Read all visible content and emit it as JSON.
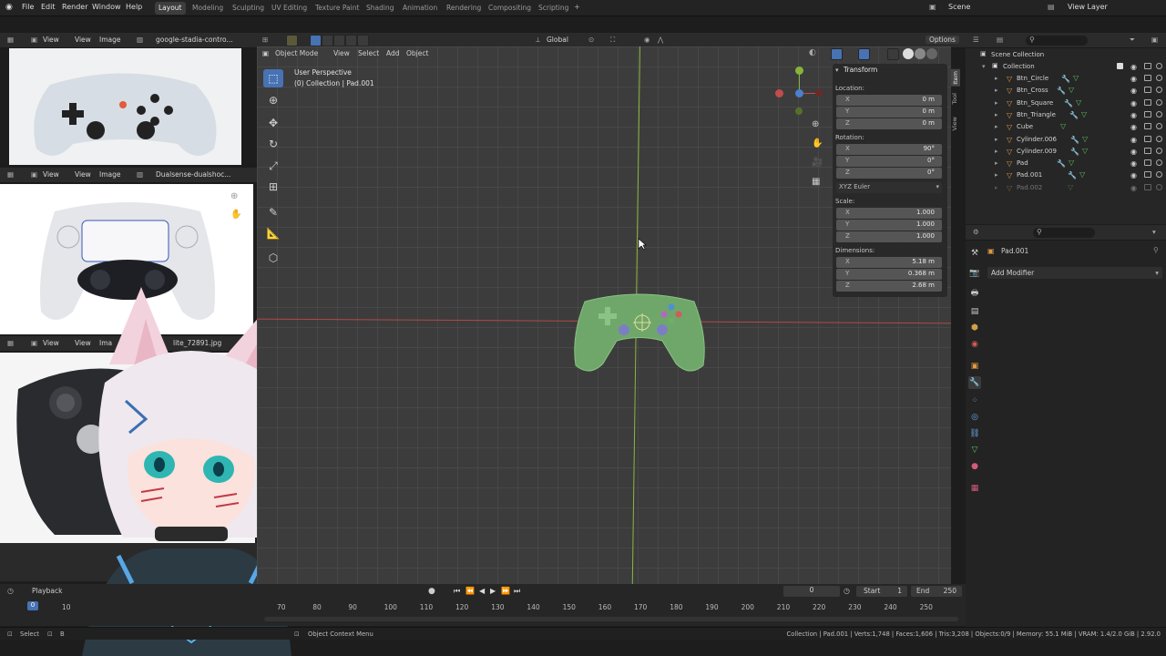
{
  "menu": {
    "file": "File",
    "edit": "Edit",
    "render": "Render",
    "window": "Window",
    "help": "Help"
  },
  "workspaces": [
    "Layout",
    "Modeling",
    "Sculpting",
    "UV Editing",
    "Texture Paint",
    "Shading",
    "Animation",
    "Rendering",
    "Compositing",
    "Scripting"
  ],
  "scene_label": "Scene",
  "view_layer_label": "View Layer",
  "image_editors": [
    {
      "view": "View",
      "view2": "View",
      "image": "Image",
      "file": "google-stadia-contro..."
    },
    {
      "view": "View",
      "view2": "View",
      "image": "Image",
      "file": "Dualsense-dualshoc..."
    },
    {
      "view": "View",
      "view2": "View",
      "image": "Ima",
      "file": "lite_72891.jpg"
    }
  ],
  "viewport": {
    "transform_orientation": "Global",
    "options": "Options",
    "mode": "Object Mode",
    "menu_view": "View",
    "menu_select": "Select",
    "menu_add": "Add",
    "menu_object": "Object",
    "perspective": "User Perspective",
    "collection_info": "(0) Collection | Pad.001"
  },
  "npanel": {
    "title": "Transform",
    "location_label": "Location:",
    "rotation_label": "Rotation:",
    "scale_label": "Scale:",
    "dimensions_label": "Dimensions:",
    "rotation_mode": "XYZ Euler",
    "location": [
      {
        "axis": "X",
        "value": "0 m"
      },
      {
        "axis": "Y",
        "value": "0 m"
      },
      {
        "axis": "Z",
        "value": "0 m"
      }
    ],
    "rotation": [
      {
        "axis": "X",
        "value": "90°"
      },
      {
        "axis": "Y",
        "value": "0°"
      },
      {
        "axis": "Z",
        "value": "0°"
      }
    ],
    "scale": [
      {
        "axis": "X",
        "value": "1.000"
      },
      {
        "axis": "Y",
        "value": "1.000"
      },
      {
        "axis": "Z",
        "value": "1.000"
      }
    ],
    "dimensions": [
      {
        "axis": "X",
        "value": "5.18 m"
      },
      {
        "axis": "Y",
        "value": "0.368 m"
      },
      {
        "axis": "Z",
        "value": "2.68 m"
      }
    ],
    "side_tabs": [
      "Item",
      "Tool",
      "View"
    ]
  },
  "outliner": {
    "scene_collection": "Scene Collection",
    "collection": "Collection",
    "items": [
      "Btn_Circle",
      "Btn_Cross",
      "Btn_Square",
      "Btn_Triangle",
      "Cube",
      "Cylinder.006",
      "Cylinder.009",
      "Pad",
      "Pad.001",
      "Pad.002"
    ]
  },
  "properties": {
    "object_name": "Pad.001",
    "add_modifier": "Add Modifier"
  },
  "timeline": {
    "playback": "Playback",
    "current_frame": "0",
    "start_label": "Start",
    "start": "1",
    "end_label": "End",
    "end": "250",
    "ruler": [
      "70",
      "80",
      "90",
      "100",
      "110",
      "120",
      "130",
      "140",
      "150",
      "160",
      "170",
      "180",
      "190",
      "200",
      "210",
      "220",
      "230",
      "240",
      "250"
    ],
    "left_ruler": [
      "0",
      "10"
    ]
  },
  "status": {
    "select": "Select",
    "select2": "B",
    "context_menu": "Object Context Menu",
    "stats": "Collection | Pad.001 | Verts:1,748 | Faces:1,606 | Tris:3,208 | Objects:0/9 | Memory: 55.1 MiB | VRAM: 1.4/2.0 GiB | 2.92.0"
  },
  "colors": {
    "accent": "#4772b3",
    "grid_bg": "#3c3c3c",
    "x_axis": "#c24b4b",
    "y_axis": "#86b33a",
    "controller": "#6fa76a"
  }
}
